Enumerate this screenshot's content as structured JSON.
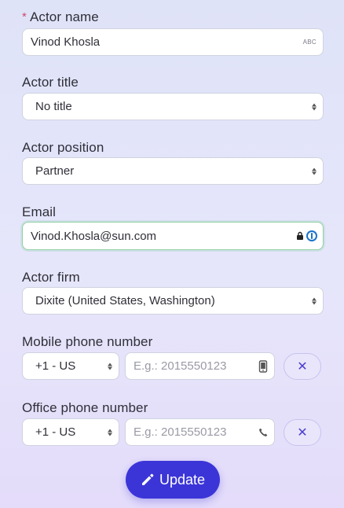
{
  "actor_name": {
    "label": "Actor name",
    "required_mark": "*",
    "value": "Vinod Khosla",
    "badge": "ABC"
  },
  "actor_title": {
    "label": "Actor title",
    "value": "No title"
  },
  "actor_position": {
    "label": "Actor position",
    "value": "Partner"
  },
  "email": {
    "label": "Email",
    "value": "Vinod.Khosla@sun.com"
  },
  "actor_firm": {
    "label": "Actor firm",
    "value": "Dixite (United States, Washington)"
  },
  "mobile_phone": {
    "label": "Mobile phone number",
    "country_code": "+1 - US",
    "placeholder": "E.g.: 2015550123",
    "clear": "✕"
  },
  "office_phone": {
    "label": "Office phone number",
    "country_code": "+1 - US",
    "placeholder": "E.g.: 2015550123",
    "clear": "✕"
  },
  "update_button": {
    "label": "Update"
  },
  "colors": {
    "accent": "#3b35d8",
    "focus_border": "#8fd0a6",
    "required": "#d04a6a"
  },
  "icons": [
    "pencil-icon",
    "mobile-phone-icon",
    "phone-icon",
    "lock-icon",
    "password-manager-icon",
    "close-icon"
  ]
}
